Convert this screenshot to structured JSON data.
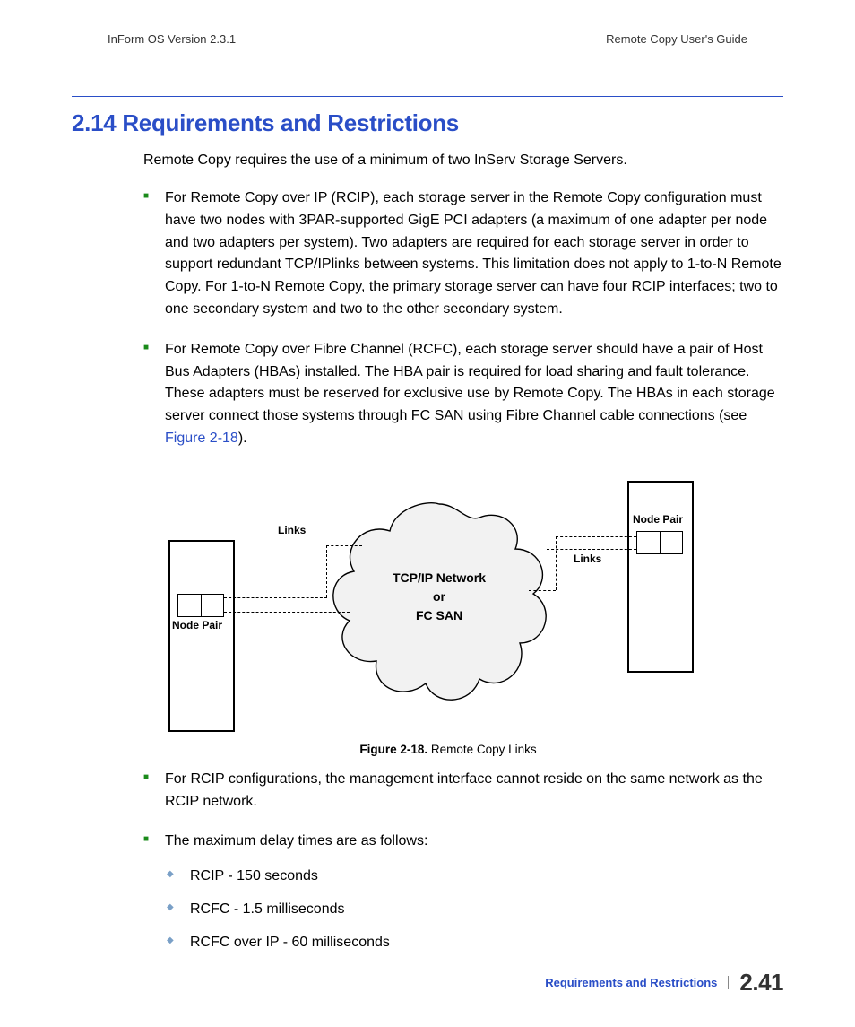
{
  "header": {
    "left": "InForm OS Version 2.3.1",
    "right": "Remote Copy User's Guide"
  },
  "section": {
    "title": "2.14 Requirements and Restrictions",
    "intro": "Remote Copy requires the use of a minimum of two InServ Storage Servers."
  },
  "bullets": {
    "b1": "For Remote Copy over IP (RCIP), each storage server in the Remote Copy configuration must have two nodes with 3PAR-supported GigE PCI adapters (a maximum of one adapter per node and two adapters per system). Two adapters are required for each storage server in order to support redundant TCP/IPlinks between systems. This limitation does not apply to 1-to-N Remote Copy. For 1-to-N Remote Copy, the primary storage server can have four RCIP interfaces; two to one secondary system and two to the other secondary system.",
    "b2_pre": "For Remote Copy over Fibre Channel (RCFC), each storage server should have a pair of Host Bus Adapters (HBAs) installed. The HBA pair is required for load sharing and fault tolerance. These adapters must be reserved for exclusive use by Remote Copy. The HBAs in each storage server connect those systems through FC SAN using Fibre Channel cable connections (see ",
    "b2_link": "Figure 2-18",
    "b2_post": ").",
    "b3": "For RCIP configurations, the management interface cannot reside on the same network as the RCIP network.",
    "b4": "The maximum delay times are as follows:",
    "sub": {
      "s1": "RCIP - 150 seconds",
      "s2": "RCFC - 1.5 milliseconds",
      "s3": "RCFC over IP - 60 milliseconds"
    }
  },
  "figure": {
    "net_line1": "TCP/IP Network",
    "net_line2": "or",
    "net_line3": "FC SAN",
    "links_label": "Links",
    "node_pair": "Node Pair",
    "caption_bold": "Figure 2-18.",
    "caption_rest": "  Remote Copy Links"
  },
  "footer": {
    "section_label": "Requirements and Restrictions",
    "page": "2.41"
  }
}
